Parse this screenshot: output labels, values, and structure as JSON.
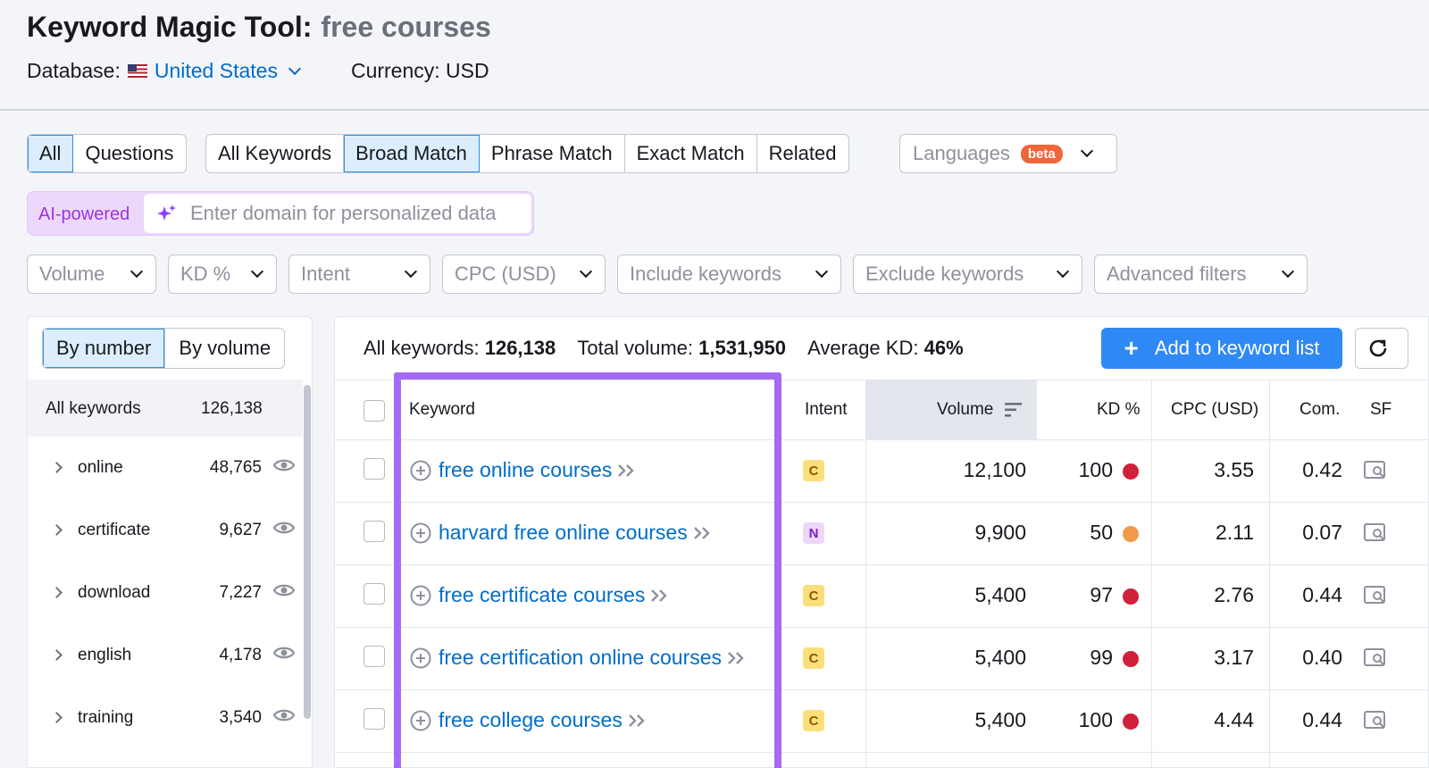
{
  "header": {
    "title": "Keyword Magic Tool:",
    "query": "free courses",
    "database_label": "Database:",
    "database_value": "United States",
    "currency": "Currency: USD"
  },
  "tabs_type": [
    {
      "label": "All",
      "active": true
    },
    {
      "label": "Questions",
      "active": false
    }
  ],
  "tabs_match": [
    {
      "label": "All Keywords",
      "active": false
    },
    {
      "label": "Broad Match",
      "active": true
    },
    {
      "label": "Phrase Match",
      "active": false
    },
    {
      "label": "Exact Match",
      "active": false
    },
    {
      "label": "Related",
      "active": false
    }
  ],
  "languages": {
    "label": "Languages",
    "badge": "beta"
  },
  "ai": {
    "label": "AI-powered",
    "placeholder": "Enter domain for personalized data"
  },
  "filters": [
    "Volume",
    "KD %",
    "Intent",
    "CPC (USD)",
    "Include keywords",
    "Exclude keywords",
    "Advanced filters"
  ],
  "groups": {
    "toggle": [
      "By number",
      "By volume"
    ],
    "all_label": "All keywords",
    "all_count": "126,138",
    "items": [
      {
        "name": "online",
        "count": "48,765"
      },
      {
        "name": "certificate",
        "count": "9,627"
      },
      {
        "name": "download",
        "count": "7,227"
      },
      {
        "name": "english",
        "count": "4,178"
      },
      {
        "name": "training",
        "count": "3,540"
      }
    ]
  },
  "summary": {
    "all_label": "All keywords:",
    "all_value": "126,138",
    "volume_label": "Total volume:",
    "volume_value": "1,531,950",
    "kd_label": "Average KD:",
    "kd_value": "46%"
  },
  "add_button": "Add to keyword list",
  "columns": {
    "keyword": "Keyword",
    "intent": "Intent",
    "volume": "Volume",
    "kd": "KD %",
    "cpc": "CPC (USD)",
    "com": "Com.",
    "sf": "SF"
  },
  "rows": [
    {
      "keyword": "free online courses",
      "intent": "C",
      "volume": "12,100",
      "kd": "100",
      "kd_color": "#d1203a",
      "cpc": "3.55",
      "com": "0.42"
    },
    {
      "keyword": "harvard free online courses",
      "intent": "N",
      "volume": "9,900",
      "kd": "50",
      "kd_color": "#f2994a",
      "cpc": "2.11",
      "com": "0.07"
    },
    {
      "keyword": "free certificate courses",
      "intent": "C",
      "volume": "5,400",
      "kd": "97",
      "kd_color": "#d1203a",
      "cpc": "2.76",
      "com": "0.44"
    },
    {
      "keyword": "free certification online courses",
      "intent": "C",
      "volume": "5,400",
      "kd": "99",
      "kd_color": "#d1203a",
      "cpc": "3.17",
      "com": "0.40"
    },
    {
      "keyword": "free college courses",
      "intent": "C",
      "volume": "5,400",
      "kd": "100",
      "kd_color": "#d1203a",
      "cpc": "4.44",
      "com": "0.44"
    }
  ],
  "colors": {
    "accent": "#2f89f5",
    "link": "#006dca",
    "highlight": "#a46af5"
  }
}
